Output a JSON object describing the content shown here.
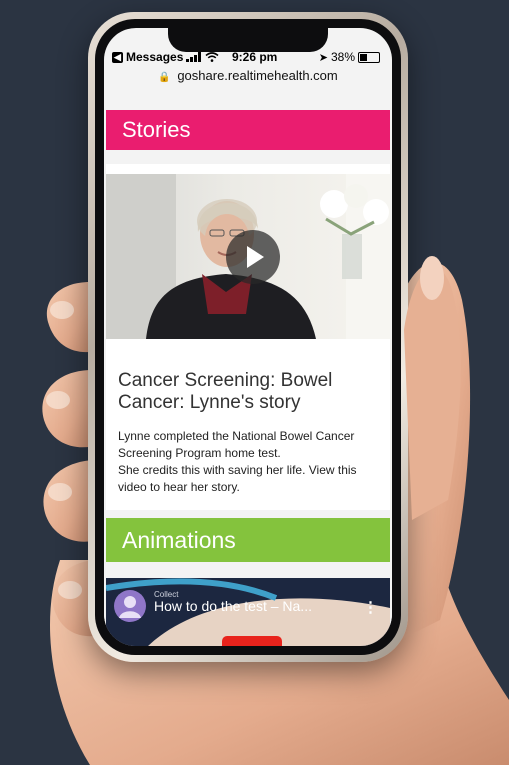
{
  "status_bar": {
    "back_app": "Messages",
    "time": "9:26 pm",
    "battery": "38%",
    "battery_level": 0.38
  },
  "url_bar": {
    "url": "goshare.realtimehealth.com"
  },
  "stories_section": {
    "heading": "Stories"
  },
  "story_card": {
    "title": "Cancer Screening: Bowel Cancer: Lynne's story",
    "description_line1": "Lynne completed the National Bowel Cancer Screening Program home test.",
    "description_line2": "She credits this with saving her life. View this video to hear her story."
  },
  "animations_section": {
    "heading": "Animations"
  },
  "embedded_video": {
    "channel": "Collect",
    "title": "How to do the test – Na..."
  },
  "colors": {
    "stories_banner": "#ea1d6f",
    "animations_banner": "#84c33d",
    "background": "#2b3442"
  },
  "icons": [
    "back-arrow-icon",
    "signal-icon",
    "wifi-icon",
    "location-arrow-icon",
    "battery-icon",
    "lock-icon",
    "play-icon",
    "channel-avatar-icon",
    "more-options-icon"
  ]
}
